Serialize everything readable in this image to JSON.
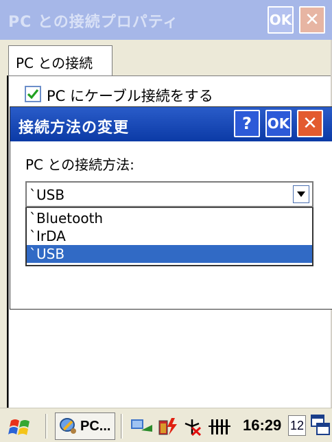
{
  "background_window": {
    "title": "PC との接続プロパティ",
    "ok_label": "OK",
    "close_glyph": "✕",
    "tab_label": "PC との接続",
    "checkbox_label": "PC にケーブル接続をする",
    "checkbox_checked": true
  },
  "dialog": {
    "title": "接続方法の変更",
    "help_glyph": "?",
    "ok_label": "OK",
    "close_glyph": "✕",
    "field_label": "PC との接続方法:",
    "combo_value": "`USB",
    "options": [
      "`Bluetooth",
      "`IrDA",
      "`USB"
    ],
    "selected_option": "`USB"
  },
  "taskbar": {
    "app_label": "PC...",
    "time": "16:29",
    "date": "12"
  },
  "colors": {
    "dialog_title_bg": "#0b3aa6",
    "selection": "#316ac5",
    "close_button": "#e35b2f"
  }
}
